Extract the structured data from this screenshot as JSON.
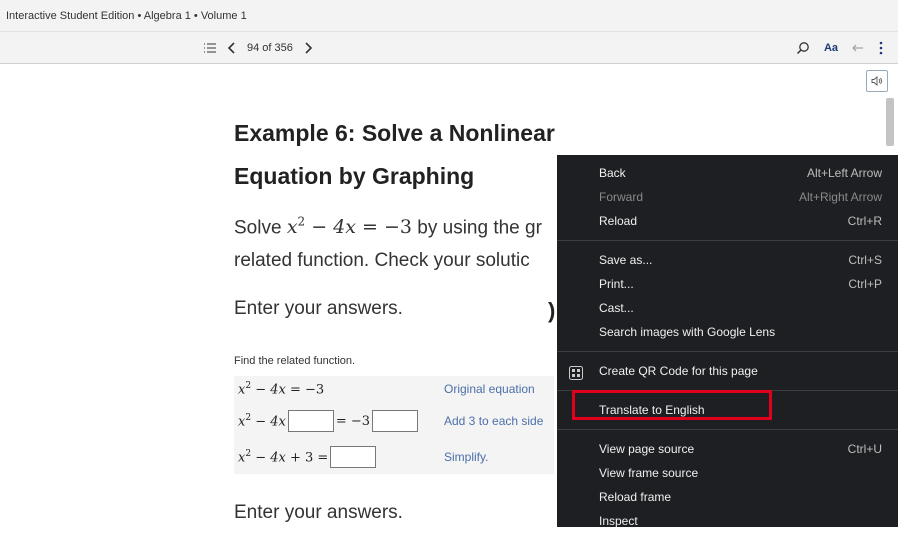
{
  "breadcrumb": "Interactive Student Edition • Algebra 1 • Volume 1",
  "nav": {
    "page_indicator": "94 of 356",
    "font_button": "Aa"
  },
  "content": {
    "title_line1": "Example 6: Solve a Nonlinear",
    "title_line2": "Equation by Graphing",
    "solve_prefix": "Solve ",
    "solve_suffix": " by using the gr",
    "para_line2": "related function. Check your solutic",
    "enter_answers": "Enter your answers.",
    "find_related": "Find the related function.",
    "rows": [
      {
        "note": "Original equation"
      },
      {
        "note": "Add 3 to each side"
      },
      {
        "note": "Simplify."
      }
    ],
    "enter_answers_bottom": "Enter your answers."
  },
  "context_menu": {
    "items": [
      {
        "label": "Back",
        "shortcut": "Alt+Left Arrow",
        "disabled": false
      },
      {
        "label": "Forward",
        "shortcut": "Alt+Right Arrow",
        "disabled": true
      },
      {
        "label": "Reload",
        "shortcut": "Ctrl+R",
        "disabled": false
      },
      {
        "label": "Save as...",
        "shortcut": "Ctrl+S",
        "disabled": false
      },
      {
        "label": "Print...",
        "shortcut": "Ctrl+P",
        "disabled": false
      },
      {
        "label": "Cast...",
        "shortcut": "",
        "disabled": false
      },
      {
        "label": "Search images with Google Lens",
        "shortcut": "",
        "disabled": false
      },
      {
        "label": "Create QR Code for this page",
        "shortcut": "",
        "disabled": false
      },
      {
        "label": "Translate to English",
        "shortcut": "",
        "disabled": false
      },
      {
        "label": "View page source",
        "shortcut": "Ctrl+U",
        "disabled": false
      },
      {
        "label": "View frame source",
        "shortcut": "",
        "disabled": false
      },
      {
        "label": "Reload frame",
        "shortcut": "",
        "disabled": false
      },
      {
        "label": "Inspect",
        "shortcut": "",
        "disabled": false
      }
    ]
  },
  "colors": {
    "menu_bg": "#1e1f22",
    "highlight_border": "#e0001b",
    "note_blue": "#4b6fa8"
  }
}
